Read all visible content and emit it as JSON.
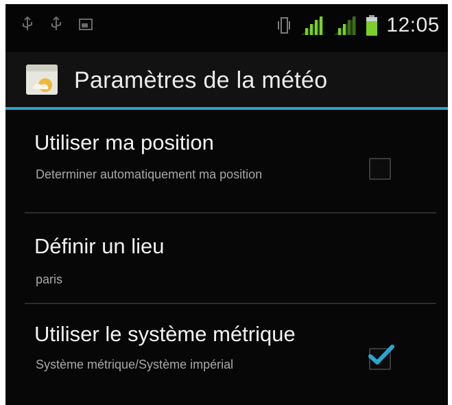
{
  "status_bar": {
    "time": "12:05",
    "icons": [
      "usb-icon",
      "usb-debug-icon",
      "screenshot-icon",
      "vibrate-icon",
      "signal-icon",
      "signal-icon",
      "battery-icon"
    ]
  },
  "app_bar": {
    "title": "Paramètres de la météo",
    "icon": "weather-app-icon"
  },
  "settings": [
    {
      "title": "Utiliser ma position",
      "summary": "Determiner automatiquement ma position",
      "checked": false
    },
    {
      "title": "Définir un lieu",
      "summary": "paris"
    },
    {
      "title": "Utiliser le système métrique",
      "summary": "Système métrique/Système impérial",
      "checked": true
    }
  ],
  "colors": {
    "accent": "#2aa6cf",
    "signal": "#7ccf2a",
    "battery": "#7ccf2a",
    "checkmark": "#2aa6cf"
  }
}
